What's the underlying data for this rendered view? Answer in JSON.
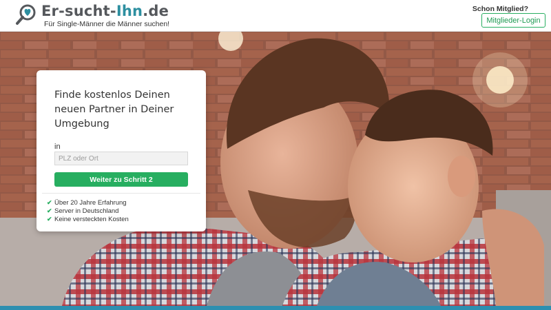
{
  "header": {
    "logo_prefix": "Er-sucht-",
    "logo_highlight": "Ihn",
    "logo_suffix": ".de",
    "tagline": "Für Single-Männer die Männer suchen!",
    "member_question": "Schon Mitglied?",
    "login_label": "Mitglieder-Login"
  },
  "card": {
    "title": "Finde kostenlos Deinen neuen Partner in Deiner Umgebung",
    "field_label": "in",
    "location_placeholder": "PLZ oder Ort",
    "location_value": "",
    "next_label": "Weiter zu Schritt 2",
    "features": [
      {
        "icon": "check-icon",
        "label": "Über 20 Jahre Erfahrung"
      },
      {
        "icon": "check-icon",
        "label": "Server in Deutschland"
      },
      {
        "icon": "check-icon",
        "label": "Keine versteckten Kosten"
      }
    ]
  },
  "colors": {
    "accent_green": "#27ae60",
    "brand_teal": "#2d8fa0",
    "footer_blue": "#2d8fb0"
  }
}
